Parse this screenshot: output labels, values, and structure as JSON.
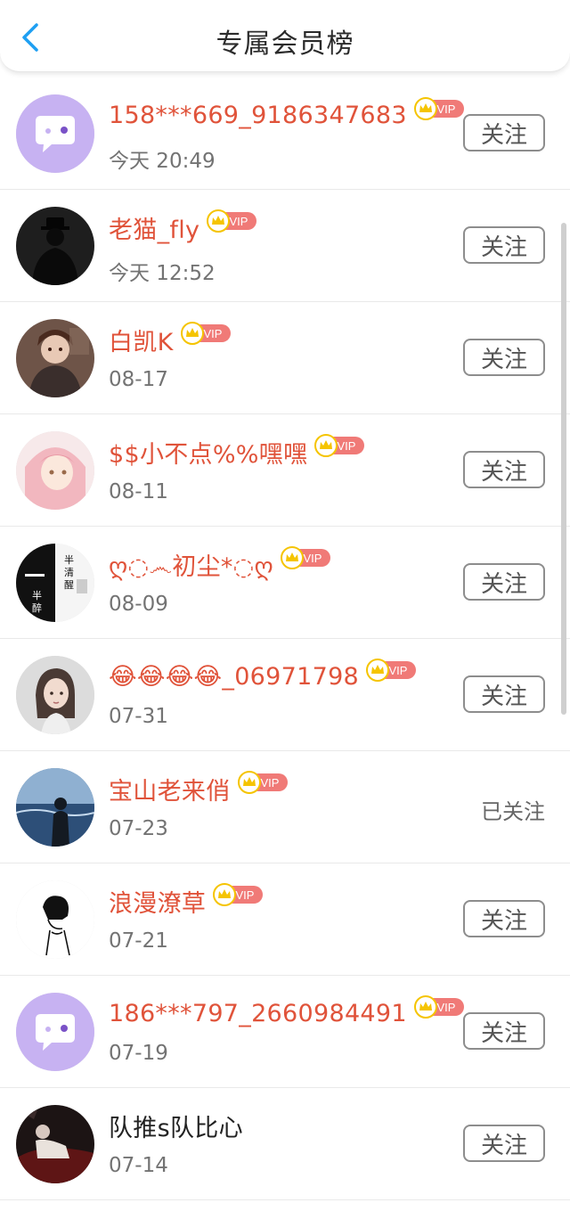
{
  "header": {
    "title": "专属会员榜"
  },
  "vip_badge": "VIP",
  "colors": {
    "name": "#e0533a",
    "accent": "#1e9ff2",
    "vip": "#f07a77",
    "crown": "#f5c400"
  },
  "rows": [
    {
      "name": "158***669_9186347683",
      "date": "今天 20:49",
      "action": "关注",
      "followed": false,
      "avatar": "default-chat"
    },
    {
      "name": "老猫_fly",
      "date": "今天 12:52",
      "action": "关注",
      "followed": false,
      "avatar": "dark-figure"
    },
    {
      "name": "白凯K",
      "date": "08-17",
      "action": "关注",
      "followed": false,
      "avatar": "anime-character"
    },
    {
      "name": "$$小不点%%嘿嘿",
      "date": "08-11",
      "action": "关注",
      "followed": false,
      "avatar": "pink-anime"
    },
    {
      "name": "ღ◌෴初尘*◌ღ",
      "date": "08-09",
      "action": "关注",
      "followed": false,
      "avatar": "calligraphy"
    },
    {
      "name": "😂😂😂😂_06971798",
      "date": "07-31",
      "action": "关注",
      "followed": false,
      "avatar": "girl-portrait"
    },
    {
      "name": "宝山老来俏",
      "date": "07-23",
      "action": "已关注",
      "followed": true,
      "avatar": "sea-silhouette"
    },
    {
      "name": "浪漫潦草",
      "date": "07-21",
      "action": "关注",
      "followed": false,
      "avatar": "sketch-boy"
    },
    {
      "name": "186***797_2660984491",
      "date": "07-19",
      "action": "关注",
      "followed": false,
      "avatar": "default-chat"
    },
    {
      "name": "队推s队比心",
      "date": "07-14",
      "action": "关注",
      "followed": false,
      "avatar": "dark-photo",
      "plain": true
    }
  ]
}
